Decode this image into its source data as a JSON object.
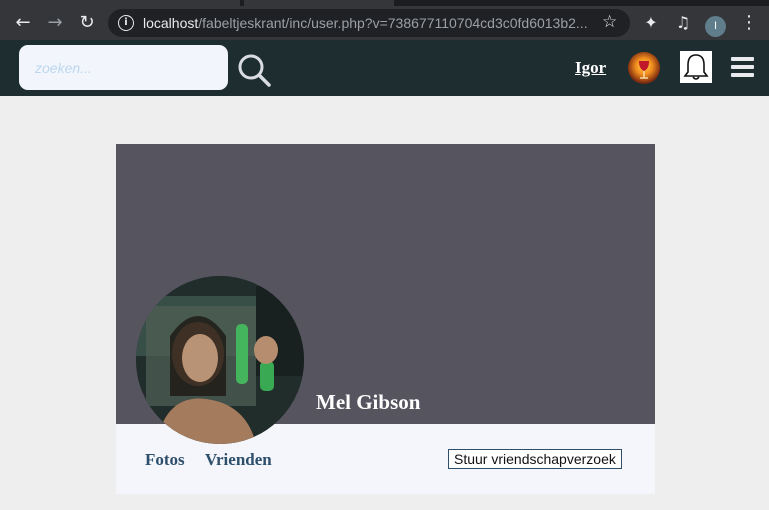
{
  "browser": {
    "url_host": "localhost",
    "url_rest": "/fabeltjeskrant/inc/user.php?v=738677110704cd3c0fd6013b2...",
    "profile_initial": "I"
  },
  "header": {
    "search_placeholder": "zoeken...",
    "username": "Igor"
  },
  "profile": {
    "name": "Mel Gibson",
    "tabs": [
      {
        "label": "Fotos"
      },
      {
        "label": "Vrienden"
      }
    ],
    "friend_request_label": "Stuur vriendschapverzoek"
  },
  "colors": {
    "header_bg": "#1e2d30",
    "cover_bg": "#55545f",
    "tab_link": "#2e4f6b"
  }
}
